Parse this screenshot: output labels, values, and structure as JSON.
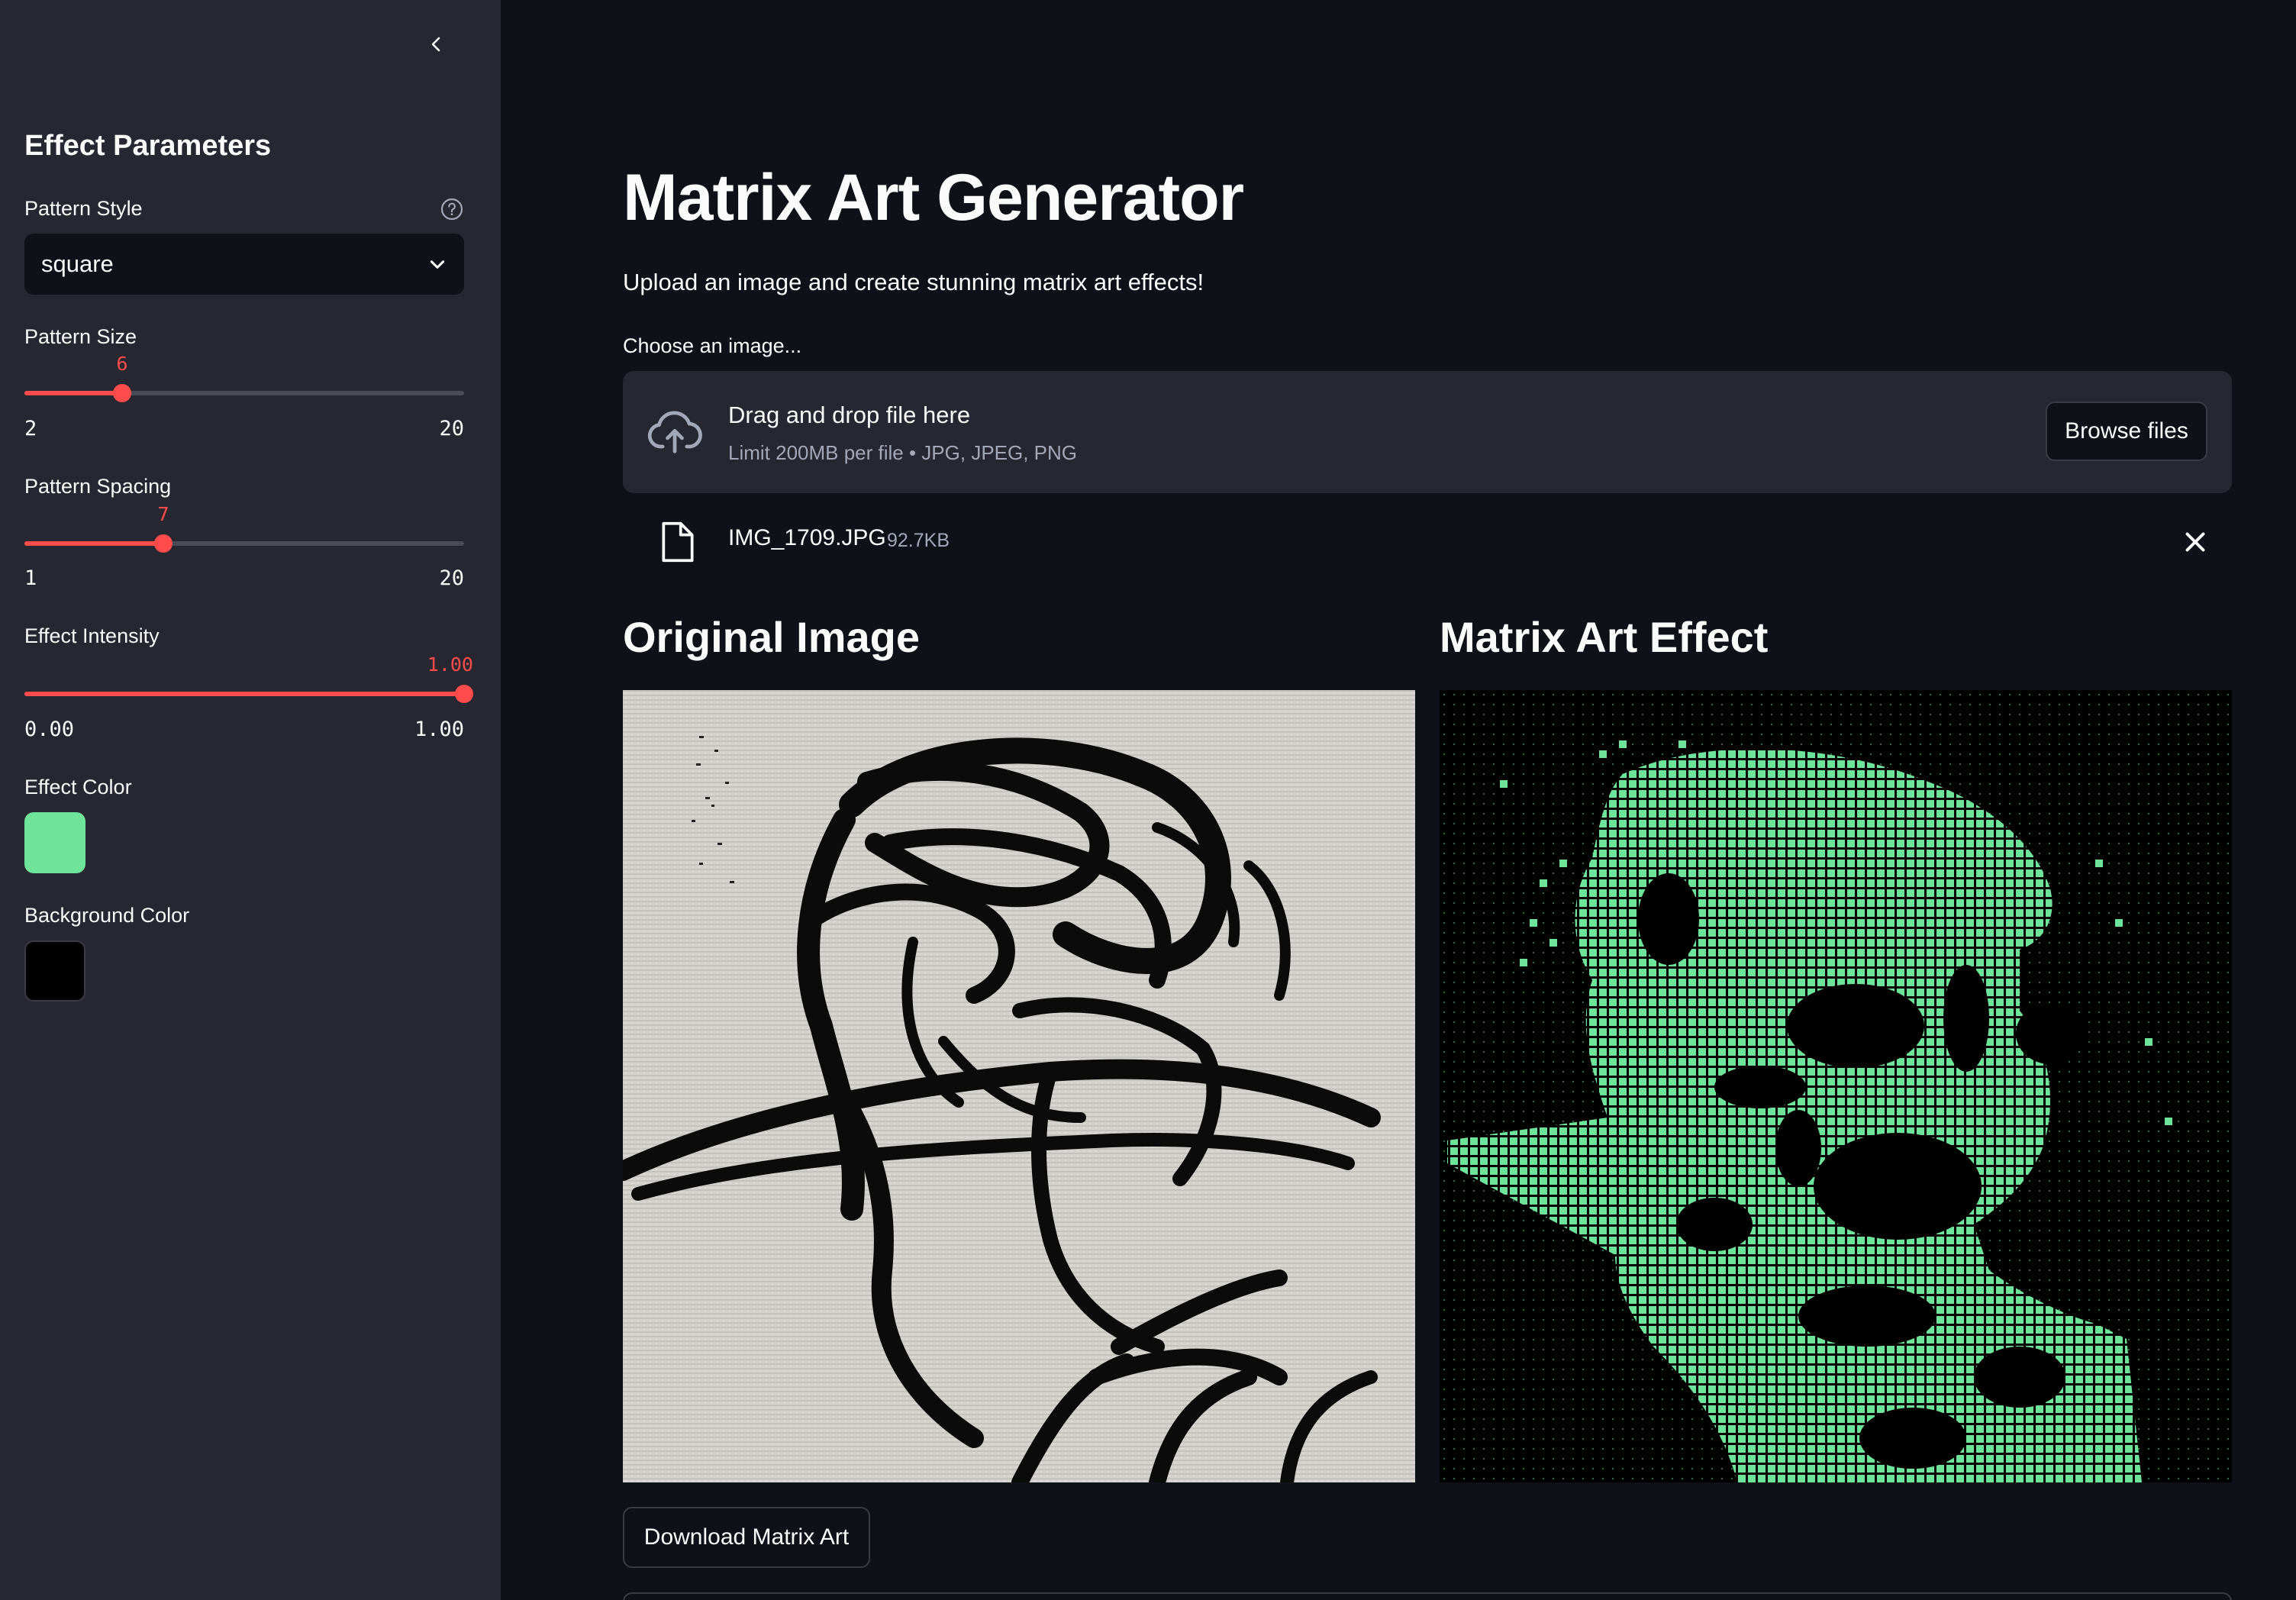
{
  "sidebar": {
    "title": "Effect Parameters",
    "pattern_style": {
      "label": "Pattern Style",
      "value": "square"
    },
    "pattern_size": {
      "label": "Pattern Size",
      "value": "6",
      "min": "2",
      "max": "20",
      "fraction": 0.222
    },
    "pattern_spacing": {
      "label": "Pattern Spacing",
      "value": "7",
      "min": "1",
      "max": "20",
      "fraction": 0.316
    },
    "effect_intensity": {
      "label": "Effect Intensity",
      "value": "1.00",
      "min": "0.00",
      "max": "1.00",
      "fraction": 1.0
    },
    "effect_color": {
      "label": "Effect Color",
      "color": "#6ee39a"
    },
    "background_color": {
      "label": "Background Color",
      "color": "#000000"
    }
  },
  "main": {
    "title": "Matrix Art Generator",
    "subtitle": "Upload an image and create stunning matrix art effects!",
    "uploader": {
      "label": "Choose an image...",
      "drop_text": "Drag and drop file here",
      "limit_text": "Limit 200MB per file • JPG, JPEG, PNG",
      "browse_label": "Browse files"
    },
    "file": {
      "name": "IMG_1709.JPG",
      "size": "92.7KB"
    },
    "original_title": "Original Image",
    "effect_title": "Matrix Art Effect",
    "download_label": "Download Matrix Art"
  },
  "colors": {
    "accent": "#ff4b4b",
    "app_bg": "#0e1117",
    "sidebar_bg": "#262730",
    "matrix_green": "#6ee39a"
  }
}
